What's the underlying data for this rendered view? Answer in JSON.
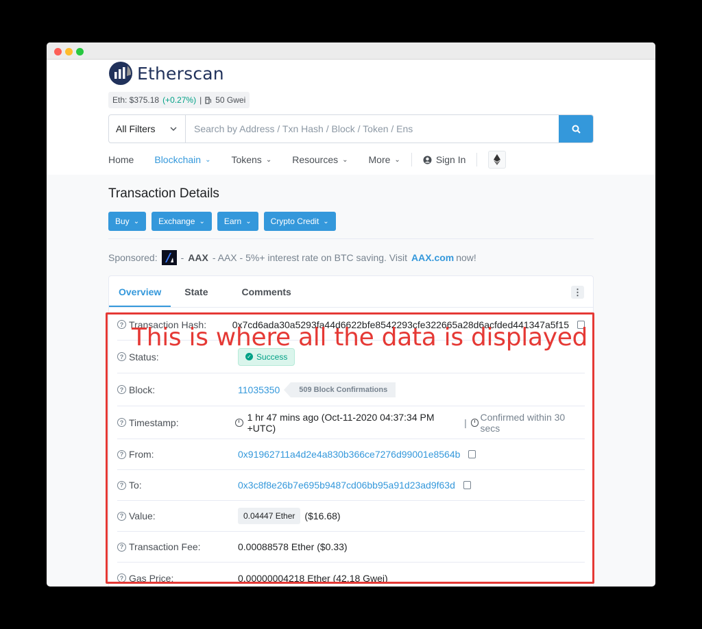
{
  "brand": {
    "name": "Etherscan"
  },
  "price_bar": {
    "eth_label": "Eth: $375.18",
    "change": "(+0.27%)",
    "divider": "|",
    "gas": "50 Gwei"
  },
  "search": {
    "filter": "All Filters",
    "placeholder": "Search by Address / Txn Hash / Block / Token / Ens"
  },
  "nav": {
    "home": "Home",
    "blockchain": "Blockchain",
    "tokens": "Tokens",
    "resources": "Resources",
    "more": "More",
    "sign_in": "Sign In"
  },
  "page": {
    "title": "Transaction Details"
  },
  "promo": {
    "buy": "Buy",
    "exchange": "Exchange",
    "earn": "Earn",
    "crypto_credit": "Crypto Credit"
  },
  "sponsored": {
    "label": "Sponsored:",
    "dash1": "-",
    "brand": "AAX",
    "text": "- AAX - 5%+ interest rate on BTC saving. Visit",
    "link": "AAX.com",
    "tail": "now!"
  },
  "tabs": {
    "overview": "Overview",
    "state": "State",
    "comments": "Comments",
    "menu": "⋮"
  },
  "details": {
    "hash_label": "Transaction Hash:",
    "hash_value": "0x7cd6ada30a5293fa44d6622bfe8542293cfe322665a28d6acfded441347a5f15",
    "status_label": "Status:",
    "status_value": "Success",
    "block_label": "Block:",
    "block_value": "11035350",
    "block_confirmations": "509 Block Confirmations",
    "timestamp_label": "Timestamp:",
    "timestamp_value": "1 hr 47 mins ago (Oct-11-2020 04:37:34 PM +UTC)",
    "timestamp_sep": "|",
    "timestamp_confirmed": "Confirmed within 30 secs",
    "from_label": "From:",
    "from_value": "0x91962711a4d2e4a830b366ce7276d99001e8564b",
    "to_label": "To:",
    "to_value": "0x3c8f8e26b7e695b9487cd06bb95a91d23ad9f63d",
    "value_label": "Value:",
    "value_ether": "0.04447 Ether",
    "value_usd": "($16.68)",
    "fee_label": "Transaction Fee:",
    "fee_value": "0.00088578 Ether ($0.33)",
    "gas_label": "Gas Price:",
    "gas_value": "0.00000004218 Ether (42.18 Gwei)"
  },
  "annotation": {
    "text": "This is where all the data is displayed",
    "color": "#e53935"
  },
  "colors": {
    "accent": "#3498db",
    "success": "#00a186",
    "brand_dark": "#21325b"
  }
}
